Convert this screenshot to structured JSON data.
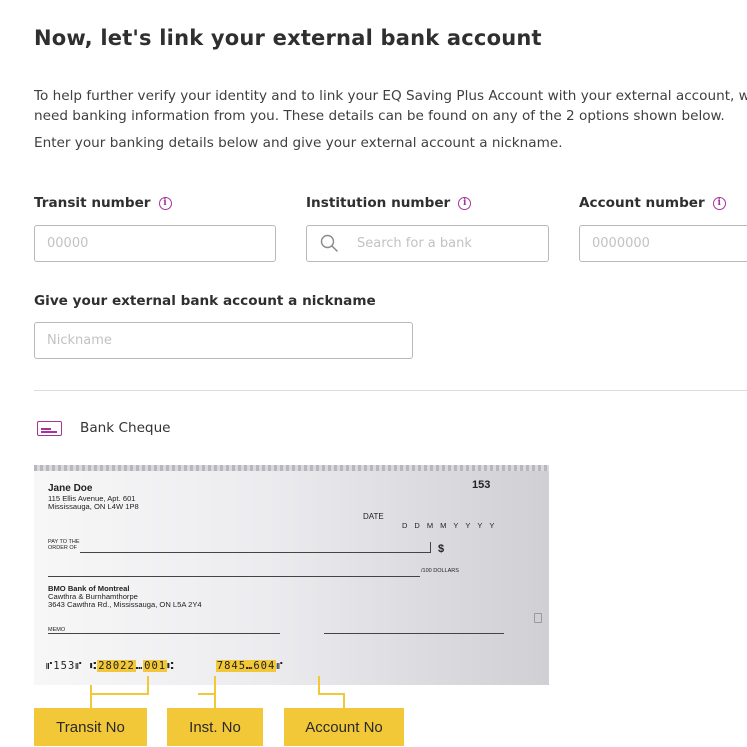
{
  "page": {
    "title": "Now, let's link your external bank account",
    "intro": "To help further verify your identity and to link your EQ Saving Plus Account with your external account, we'll need banking information from you. These details can be found on any of the 2 options shown below.",
    "intro2": "Enter your banking details below and give your external account a nickname."
  },
  "form": {
    "transit": {
      "label": "Transit number",
      "placeholder": "00000"
    },
    "institution": {
      "label": "Institution number",
      "placeholder": "Search for a bank"
    },
    "account": {
      "label": "Account number",
      "placeholder": "0000000"
    },
    "nickname": {
      "label": "Give your external bank account a nickname",
      "placeholder": "Nickname"
    }
  },
  "cheque_section": {
    "title": "Bank Cheque",
    "icon": "cheque-icon"
  },
  "cheque": {
    "name": "Jane Doe",
    "address1": "115 Ellis Avenue, Apt. 601",
    "address2": "Mississauga, ON L4W 1P8",
    "number": "153",
    "date_label": "DATE",
    "date_format": "DDMMYYYY",
    "pay_to_1": "PAY TO THE",
    "pay_to_2": "ORDER OF",
    "dollar_sign": "$",
    "dollars": "/100 DOLLARS",
    "bank_name": "BMO Bank of Montreal",
    "bank_branch": "Cawthra & Burnhamthorpe",
    "bank_address": "3643 Cawthra Rd., Mississauga, ON L5A 2Y4",
    "memo": "MEMO",
    "micr_cheque": "⑈153⑈",
    "micr_transit": "28022",
    "micr_inst": "001",
    "micr_account": "7845",
    "micr_account2": "604",
    "highlight_color": "#f2c738"
  },
  "tags": {
    "transit": "Transit No",
    "inst": "Inst. No",
    "account": "Account No"
  },
  "colors": {
    "accent": "#a5339a",
    "highlight": "#f2c738"
  }
}
